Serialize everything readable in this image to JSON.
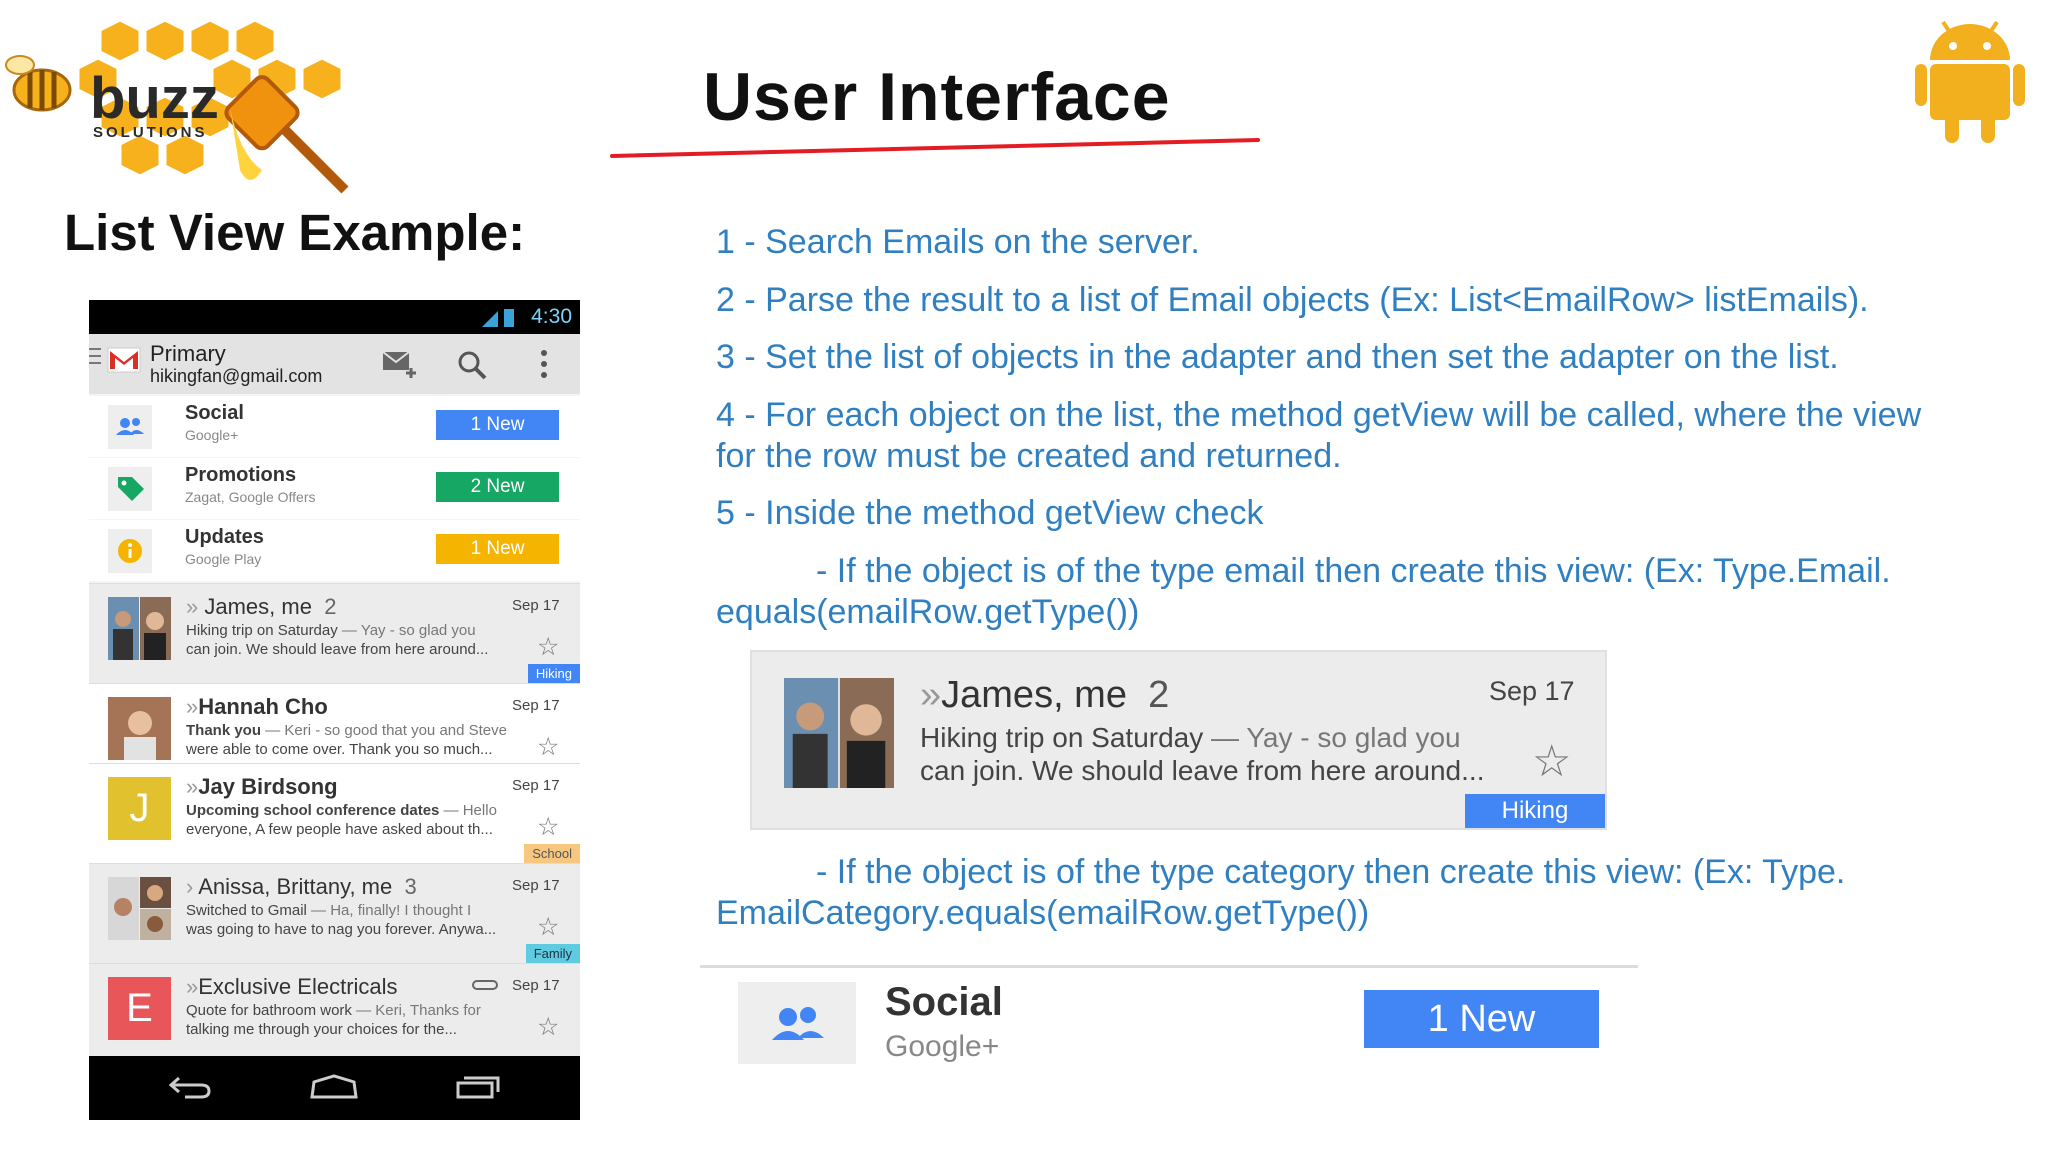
{
  "logo": {
    "brand": "buzz",
    "tagline": "SOLUTIONS"
  },
  "slide": {
    "title": "User Interface",
    "subtitle": "List View Example:",
    "colors": {
      "accent_text": "#2f7fc1",
      "title_underline": "#e31b23",
      "android_green": "#f2b01e"
    }
  },
  "points": [
    "1 - Search Emails on the server.",
    "2 - Parse the result to a list of Email objects (Ex: List<EmailRow> listEmails).",
    "3 - Set the list of objects in the adapter and then set the adapter on the list.",
    "4 - For each object on the list, the method getView will be called, where the view",
    "for the row must be created and returned.",
    "5 - Inside the method getView check",
    "- If the object is of the type email then create this view: (Ex: Type.Email.",
    "equals(emailRow.getType())",
    "- If the object is of the type category then create this view: (Ex: Type.",
    "EmailCategory.equals(emailRow.getType())"
  ],
  "phone": {
    "status_time": "4:30",
    "account": {
      "label": "Primary",
      "email": "hikingfan@gmail.com"
    },
    "icons": [
      "menu-icon",
      "gmail-icon",
      "compose-icon",
      "search-icon",
      "overflow-icon"
    ],
    "categories": [
      {
        "name": "Social",
        "sub": "Google+",
        "badge": "1 New",
        "color": "#4285f4",
        "icon": "people-icon"
      },
      {
        "name": "Promotions",
        "sub": "Zagat, Google Offers",
        "badge": "2 New",
        "color": "#16a765",
        "icon": "tag-icon"
      },
      {
        "name": "Updates",
        "sub": "Google Play",
        "badge": "1 New",
        "color": "#f4b400",
        "icon": "info-icon"
      }
    ],
    "mails": [
      {
        "sender": "James, me",
        "count": "2",
        "date": "Sep 17",
        "subject": "Hiking trip on Saturday",
        "line1": " — Yay - so glad you",
        "line2": "can join. We should leave from here around...",
        "label": "Hiking",
        "label_color": "#4285f4"
      },
      {
        "sender": "Hannah Cho",
        "count": "",
        "date": "Sep 17",
        "subject": "Thank you",
        "line1": " — Keri - so good that you and Steve",
        "line2": "were able to come over. Thank you so much...",
        "label": "",
        "label_color": ""
      },
      {
        "sender": "Jay Birdsong",
        "count": "",
        "date": "Sep 17",
        "subject": "Upcoming school conference dates",
        "line1": " — Hello",
        "line2": "everyone, A few people have asked about th...",
        "label": "School",
        "label_color": "#f7c77f",
        "avatar_letter": "J",
        "avatar_color": "#e2c12e"
      },
      {
        "sender": "Anissa, Brittany, me",
        "count": "3",
        "date": "Sep 17",
        "subject": "Switched to Gmail",
        "line1": " — Ha, finally! I thought I",
        "line2": "was going to have to nag you forever. Anywa...",
        "label": "Family",
        "label_color": "#5fcbe1"
      },
      {
        "sender": "Exclusive Electricals",
        "count": "",
        "date": "Sep 17",
        "subject": "Quote for bathroom work",
        "line1": " — Keri, Thanks for",
        "line2": "talking me through your choices for the...",
        "label": "",
        "label_color": "",
        "avatar_letter": "E",
        "avatar_color": "#e8565a"
      }
    ]
  },
  "zoom_mail": {
    "sender": "James, me",
    "count": "2",
    "date": "Sep 17",
    "subject": "Hiking trip on Saturday",
    "line1": " — Yay - so glad you",
    "line2": "can join. We should leave from here around...",
    "label": "Hiking"
  },
  "zoom_category": {
    "name": "Social",
    "sub": "Google+",
    "badge": "1 New"
  }
}
